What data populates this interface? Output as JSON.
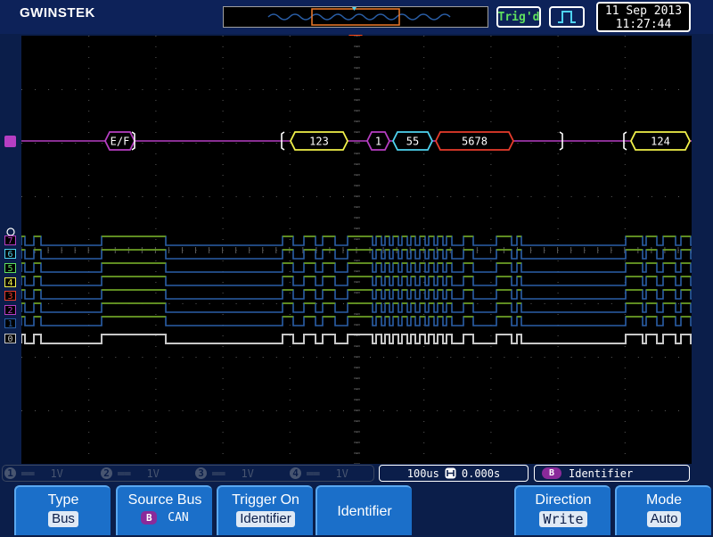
{
  "header": {
    "logo": "GWINSTEK",
    "trig_status": "Trig'd",
    "date": "11 Sep 2013",
    "time": "11:27:44"
  },
  "colors": {
    "background": "#0b1e4a",
    "screen": "#000000",
    "grid": "#5a5a5a",
    "bus_trace": "#b63ec2",
    "yellow_frame": "#f2f24a",
    "cyan_frame": "#4fd4f0",
    "red_frame": "#e83c2c",
    "digital_green": "#6a9a1a",
    "digital_blue": "#2a5fa8",
    "d0_gray": "#c8c8c8",
    "trigger_marker": "#ff4a1a",
    "softkey_blue": "#1b6fc9"
  },
  "bus": {
    "label": "B",
    "decodes": [
      "E/F",
      "123",
      "1",
      "55",
      "5678",
      "124"
    ]
  },
  "digital_channels": [
    "7",
    "6",
    "5",
    "4",
    "3",
    "2",
    "1",
    "0"
  ],
  "channels": [
    {
      "num": "1",
      "scale": "1V"
    },
    {
      "num": "2",
      "scale": "1V"
    },
    {
      "num": "3",
      "scale": "1V"
    },
    {
      "num": "4",
      "scale": "1V"
    }
  ],
  "status": {
    "timebase": "100us",
    "delay": "0.000s",
    "trigger_bus": "B",
    "trigger_type": "Identifier"
  },
  "menu": {
    "type_title": "Type",
    "type_value": "Bus",
    "source_title": "Source Bus",
    "source_bus": "B",
    "source_protocol": "CAN",
    "trigger_on_title": "Trigger On",
    "trigger_on_value": "Identifier",
    "identifier": "Identifier",
    "direction_title": "Direction",
    "direction_value": "Write",
    "mode_title": "Mode",
    "mode_value": "Auto"
  }
}
